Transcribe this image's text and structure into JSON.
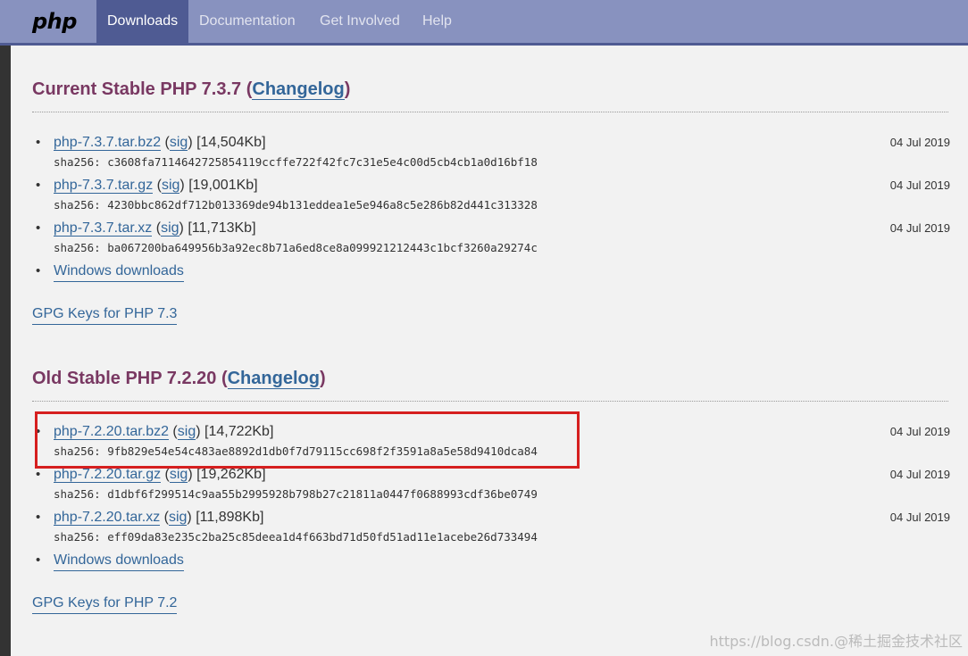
{
  "nav": {
    "logo": "php",
    "items": [
      {
        "label": "Downloads",
        "active": true
      },
      {
        "label": "Documentation",
        "active": false
      },
      {
        "label": "Get Involved",
        "active": false
      },
      {
        "label": "Help",
        "active": false
      }
    ]
  },
  "sections": [
    {
      "title": "Current Stable PHP 7.3.7 (",
      "changelog": "Changelog",
      "close": ")",
      "downloads": [
        {
          "file": "php-7.3.7.tar.bz2",
          "sig": "sig",
          "size": "[14,504Kb]",
          "date": "04 Jul 2019",
          "sha256": "sha256: c3608fa7114642725854119ccffe722f42fc7c31e5e4c00d5cb4cb1a0d16bf18"
        },
        {
          "file": "php-7.3.7.tar.gz",
          "sig": "sig",
          "size": "[19,001Kb]",
          "date": "04 Jul 2019",
          "sha256": "sha256: 4230bbc862df712b013369de94b131eddea1e5e946a8c5e286b82d441c313328"
        },
        {
          "file": "php-7.3.7.tar.xz",
          "sig": "sig",
          "size": "[11,713Kb]",
          "date": "04 Jul 2019",
          "sha256": "sha256: ba067200ba649956b3a92ec8b71a6ed8ce8a099921212443c1bcf3260a29274c"
        }
      ],
      "windows": "Windows downloads",
      "gpg": "GPG Keys for PHP 7.3"
    },
    {
      "title": "Old Stable PHP 7.2.20 (",
      "changelog": "Changelog",
      "close": ")",
      "downloads": [
        {
          "file": "php-7.2.20.tar.bz2",
          "sig": "sig",
          "size": "[14,722Kb]",
          "date": "04 Jul 2019",
          "sha256": "sha256: 9fb829e54e54c483ae8892d1db0f7d79115cc698f2f3591a8a5e58d9410dca84"
        },
        {
          "file": "php-7.2.20.tar.gz",
          "sig": "sig",
          "size": "[19,262Kb]",
          "date": "04 Jul 2019",
          "sha256": "sha256: d1dbf6f299514c9aa55b2995928b798b27c21811a0447f0688993cdf36be0749"
        },
        {
          "file": "php-7.2.20.tar.xz",
          "sig": "sig",
          "size": "[11,898Kb]",
          "date": "04 Jul 2019",
          "sha256": "sha256: eff09da83e235c2ba25c85deea1d4f663bd71d50fd51ad11e1acebe26d733494"
        }
      ],
      "windows": "Windows downloads",
      "gpg": "GPG Keys for PHP 7.2"
    }
  ],
  "watermark": "https://blog.csdn.@稀土掘金技术社区",
  "colors": {
    "nav_bg": "#8892bf",
    "nav_active": "#4f5b93",
    "title": "#793862",
    "link": "#336699",
    "highlight": "#d61f1f"
  }
}
